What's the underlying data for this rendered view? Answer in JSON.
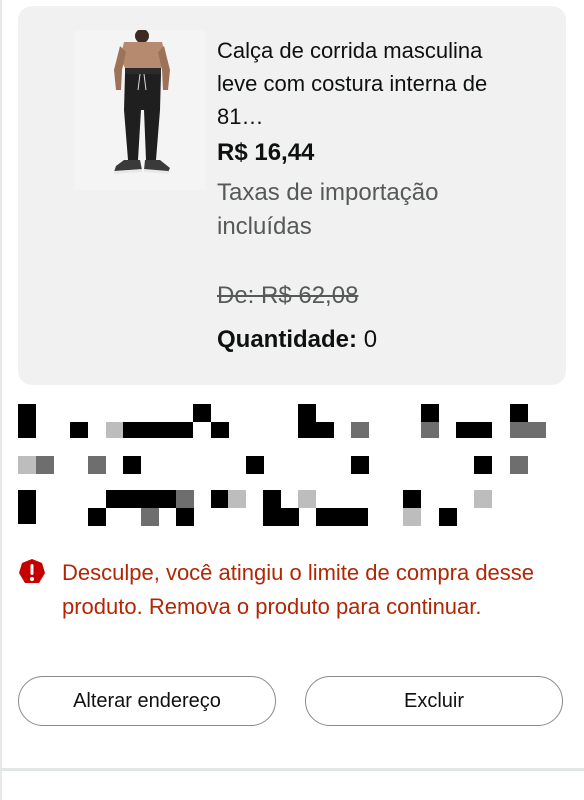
{
  "product": {
    "image_name": "running-pants-photo",
    "title": "Calça de corrida masculina leve com costura interna de 81…",
    "price": "R$ 16,44",
    "taxes_note": "Taxas de importação incluídas",
    "old_price": "De: R$ 62,08",
    "quantity_label": "Quantidade:",
    "quantity_value": "0"
  },
  "redacted_block": {
    "icon": "pixelated-redaction"
  },
  "error": {
    "icon": "alert-icon",
    "message": "Desculpe, você atingiu o limite de compra desse produto. Remova o produto para continuar."
  },
  "actions": {
    "change_address_label": "Alterar endereço",
    "delete_label": "Excluir"
  },
  "colors": {
    "card_bg": "#f1f1f1",
    "error_red": "#b12704",
    "muted_text": "#565959",
    "button_border": "#888c8c"
  }
}
